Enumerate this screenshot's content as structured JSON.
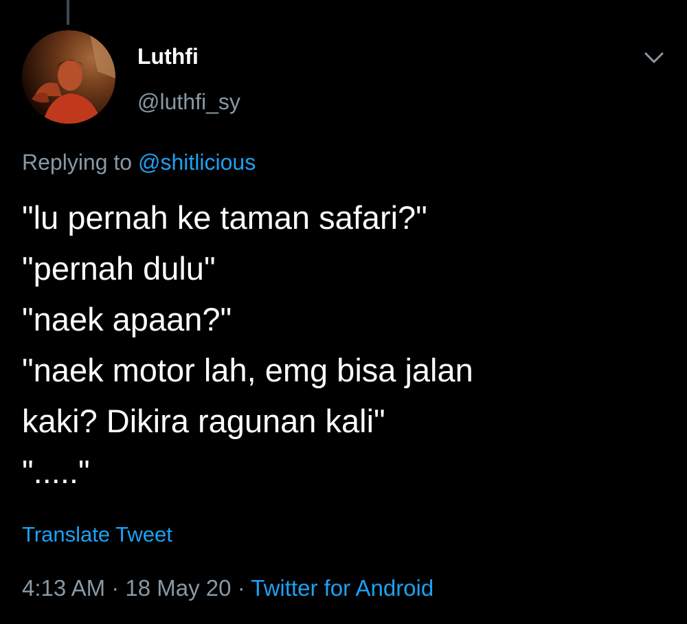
{
  "tweet": {
    "display_name": "Luthfi",
    "username": "@luthfi_sy",
    "replying_prefix": "Replying to",
    "replying_to": "@shitlicious",
    "lines": [
      "\"lu pernah ke taman safari?\"",
      "\"pernah dulu\"",
      "\"naek apaan?\"",
      "\"naek motor lah, emg bisa jalan",
      "kaki? Dikira ragunan kali\"",
      "\".....\""
    ],
    "translate_label": "Translate Tweet",
    "time": "4:13 AM",
    "separator": "·",
    "date": "18 May 20",
    "source": "Twitter for Android"
  },
  "icons": {
    "more": "chevron-down-icon",
    "avatar": "avatar"
  },
  "colors": {
    "background": "#000000",
    "text_primary": "#ffffff",
    "text_secondary": "#8899a6",
    "accent": "#1da1f2"
  }
}
